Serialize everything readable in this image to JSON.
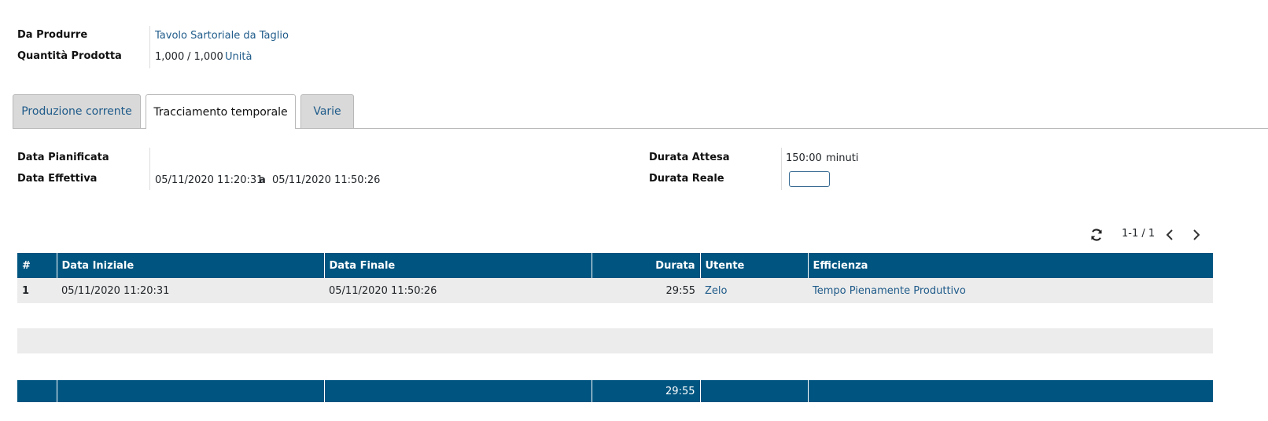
{
  "header": {
    "to_produce_label": "Da Produrre",
    "to_produce_value": "Tavolo Sartoriale da Taglio",
    "qty_label": "Quantità Prodotta",
    "qty_done": "1,000",
    "qty_total": "/ 1,000",
    "qty_uom": "Unità"
  },
  "tabs": [
    {
      "label": "Produzione corrente"
    },
    {
      "label": "Tracciamento temporale"
    },
    {
      "label": "Varie"
    }
  ],
  "timing": {
    "planned_label": "Data Pianificata",
    "planned_value": "",
    "effective_label": "Data Effettiva",
    "effective_start": "05/11/2020 11:20:31",
    "effective_sep": "a",
    "effective_end": "05/11/2020 11:50:26",
    "expected_label": "Durata Attesa",
    "expected_value": "150:00",
    "expected_unit": "minuti",
    "real_label": "Durata Reale",
    "real_value": ""
  },
  "pager": {
    "value": "1-1 / 1"
  },
  "table": {
    "headers": [
      "#",
      "Data Iniziale",
      "Data Finale",
      "Durata",
      "Utente",
      "Efficienza"
    ],
    "rows": [
      {
        "n": "1",
        "start": "05/11/2020 11:20:31",
        "end": "05/11/2020 11:50:26",
        "duration": "29:55",
        "user": "Zelo",
        "efficiency": "Tempo Pienamente Produttivo"
      }
    ],
    "footer_total": "29:55"
  },
  "colors": {
    "header_bg": "#005580",
    "link": "#1f5b8a",
    "tab_bg": "#d9d9d9"
  },
  "icons": [
    "refresh-icon",
    "chevron-left-icon",
    "chevron-right-icon"
  ]
}
